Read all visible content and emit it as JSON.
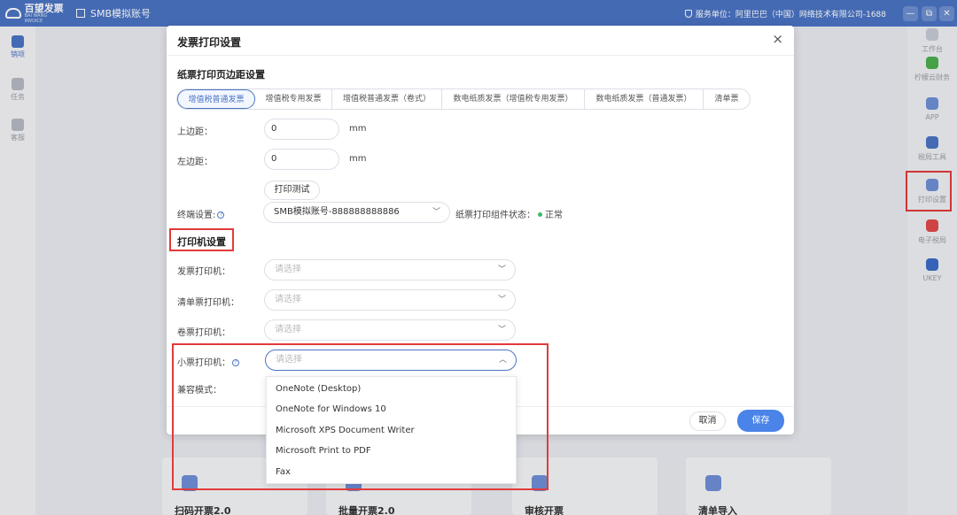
{
  "topbar": {
    "logo_name": "百望发票",
    "logo_sub": "BAI WANG INVOICE",
    "account": "SMB模拟账号",
    "service_unit": "服务单位：阿里巴巴（中国）网络技术有限公司-1688",
    "btn_min": "—",
    "btn_restore": "⧉",
    "btn_close": "✕"
  },
  "left_sidebar": [
    {
      "label": "销项",
      "active": true
    },
    {
      "label": "任务",
      "active": false
    },
    {
      "label": "客服",
      "active": false
    }
  ],
  "right_tools": [
    {
      "label": "工作台",
      "color": "#8a94a8"
    },
    {
      "label": "柠檬云财务",
      "color": "#4cae4c"
    },
    {
      "label": "APP",
      "color": "#6f8fd6"
    },
    {
      "label": "税局工具",
      "color": "#4a73c4"
    },
    {
      "label": "打印设置",
      "color": "#6f8fd6"
    },
    {
      "label": "电子税局",
      "color": "#e04a4a"
    },
    {
      "label": "UKEY",
      "color": "#3b6cc9"
    }
  ],
  "bg_cards": [
    {
      "label": "扫码开票2.0"
    },
    {
      "label": "批量开票2.0"
    },
    {
      "label": "审核开票"
    },
    {
      "label": "清单导入"
    }
  ],
  "dialog": {
    "title": "发票打印设置",
    "close": "×",
    "section_margin": "纸票打印页边距设置",
    "tabs": [
      {
        "label": "增值税普通发票",
        "active": true
      },
      {
        "label": "增值税专用发票",
        "active": false
      },
      {
        "label": "增值税普通发票（卷式）",
        "active": false
      },
      {
        "label": "数电纸质发票（增值税专用发票）",
        "active": false
      },
      {
        "label": "数电纸质发票（普通发票）",
        "active": false
      },
      {
        "label": "清单票",
        "active": false
      }
    ],
    "top_margin_label": "上边距：",
    "top_margin_value": "0",
    "left_margin_label": "左边距：",
    "left_margin_value": "0",
    "unit": "mm",
    "print_test": "打印测试",
    "terminal_label": "终端设置:",
    "terminal_value": "SMB模拟账号-888888888886",
    "component_status_label": "纸票打印组件状态：",
    "component_status_value": "正常",
    "section_printer": "打印机设置",
    "invoice_printer_label": "发票打印机：",
    "list_printer_label": "清单票打印机：",
    "roll_printer_label": "卷票打印机：",
    "receipt_printer_label": "小票打印机：",
    "compat_label": "兼容模式：",
    "placeholder": "请选择",
    "cancel": "取消",
    "save": "保存"
  },
  "dropdown_options": [
    "OneNote (Desktop)",
    "OneNote for Windows 10",
    "Microsoft XPS Document Writer",
    "Microsoft Print to PDF",
    "Fax"
  ]
}
